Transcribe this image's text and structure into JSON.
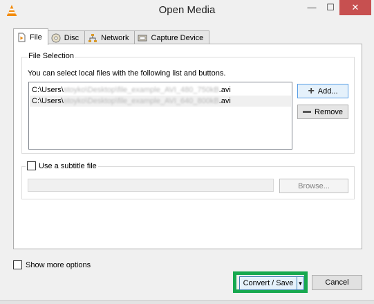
{
  "window": {
    "title": "Open Media",
    "minimize_glyph": "—",
    "maximize_glyph": "☐",
    "close_glyph": "✕"
  },
  "tabs": [
    {
      "label": "File",
      "icon": "file-icon",
      "active": true
    },
    {
      "label": "Disc",
      "icon": "disc-icon",
      "active": false
    },
    {
      "label": "Network",
      "icon": "network-icon",
      "active": false
    },
    {
      "label": "Capture Device",
      "icon": "capture-device-icon",
      "active": false
    }
  ],
  "file_selection": {
    "group_label": "File Selection",
    "instructions": "You can select local files with the following list and buttons.",
    "files": [
      {
        "prefix": "C:\\Users\\",
        "redacted": "stoyko\\Desktop\\file_example_AVI_480_750kB",
        "suffix": ".avi"
      },
      {
        "prefix": "C:\\Users\\",
        "redacted": "stoyko\\Desktop\\file_example_AVI_640_800kB",
        "suffix": ".avi"
      }
    ],
    "add_label": "Add...",
    "remove_label": "Remove"
  },
  "subtitle": {
    "label": "Use a subtitle file",
    "checked": false,
    "path_value": "",
    "browse_label": "Browse..."
  },
  "footer": {
    "show_more_label": "Show more options",
    "show_more_checked": false,
    "convert_label": "Convert / Save",
    "dropdown_glyph": "▼",
    "cancel_label": "Cancel",
    "highlight_color": "#16a84f"
  }
}
